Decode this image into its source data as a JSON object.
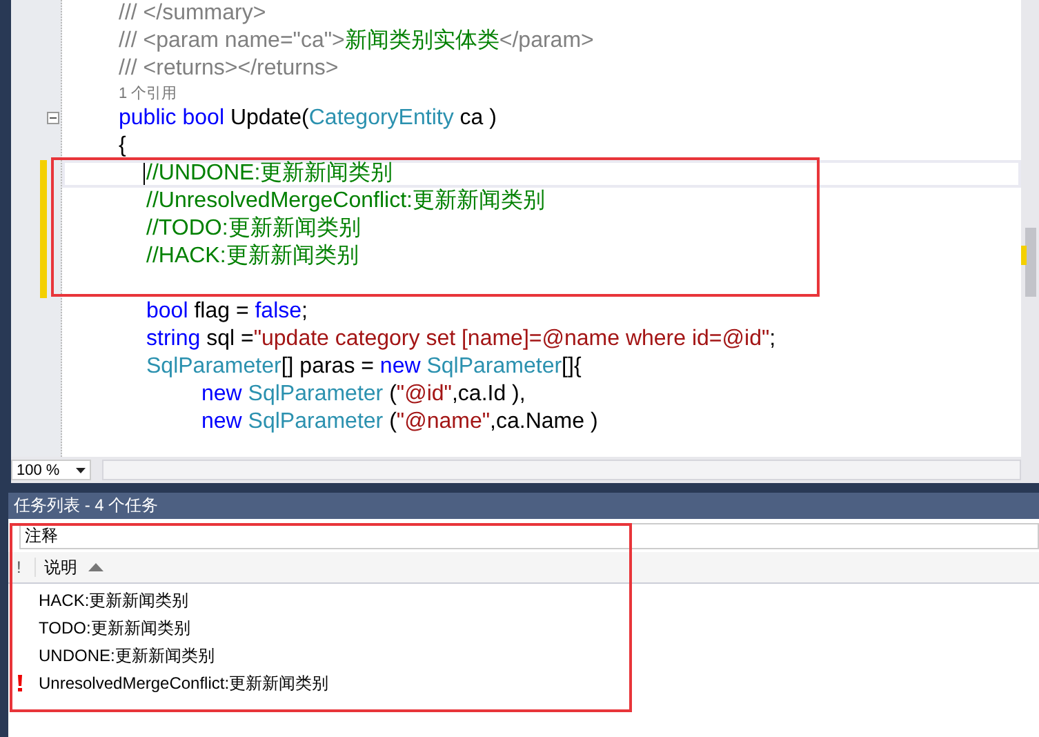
{
  "editor": {
    "lines": [
      {
        "kind": "member",
        "tokens": [
          {
            "kind": "doc",
            "text": "/// </summary>"
          }
        ]
      },
      {
        "kind": "member",
        "tokens": [
          {
            "kind": "doc",
            "text": "/// <param name=\"ca\">"
          },
          {
            "kind": "comment",
            "text": "新闻类别实体类"
          },
          {
            "kind": "doc",
            "text": "</param>"
          }
        ]
      },
      {
        "kind": "member",
        "tokens": [
          {
            "kind": "doc",
            "text": "/// <returns></returns>"
          }
        ]
      },
      {
        "kind": "lens",
        "tokens": [
          {
            "kind": "lens",
            "text": "1 个引用"
          }
        ]
      },
      {
        "kind": "member",
        "collapsible": true,
        "tokens": [
          {
            "kind": "keyword",
            "text": "public bool"
          },
          {
            "kind": "plain",
            "text": " Update("
          },
          {
            "kind": "type",
            "text": "CategoryEntity"
          },
          {
            "kind": "plain",
            "text": " ca )"
          }
        ]
      },
      {
        "kind": "member",
        "tokens": [
          {
            "kind": "plain",
            "text": "{"
          }
        ]
      },
      {
        "kind": "statement",
        "current": true,
        "changed": true,
        "tokens": [
          {
            "kind": "comment",
            "text": "//UNDONE:更新新闻类别"
          }
        ]
      },
      {
        "kind": "statement",
        "changed": true,
        "tokens": [
          {
            "kind": "comment",
            "text": "//UnresolvedMergeConflict:更新新闻类别"
          }
        ]
      },
      {
        "kind": "statement",
        "changed": true,
        "tokens": [
          {
            "kind": "comment",
            "text": "//TODO:更新新闻类别"
          }
        ]
      },
      {
        "kind": "statement",
        "changed": true,
        "tokens": [
          {
            "kind": "comment",
            "text": "//HACK:更新新闻类别"
          }
        ]
      },
      {
        "kind": "statement",
        "changed": true
      },
      {
        "kind": "statement",
        "tokens": [
          {
            "kind": "keyword",
            "text": "bool"
          },
          {
            "kind": "plain",
            "text": " flag = "
          },
          {
            "kind": "keyword",
            "text": "false"
          },
          {
            "kind": "plain",
            "text": ";"
          }
        ]
      },
      {
        "kind": "statement",
        "tokens": [
          {
            "kind": "keyword",
            "text": "string"
          },
          {
            "kind": "plain",
            "text": " sql ="
          },
          {
            "kind": "string",
            "text": "\"update category set [name]=@name where id=@id\""
          },
          {
            "kind": "plain",
            "text": ";"
          }
        ]
      },
      {
        "kind": "statement",
        "tokens": [
          {
            "kind": "type",
            "text": "SqlParameter"
          },
          {
            "kind": "plain",
            "text": "[] paras = "
          },
          {
            "kind": "keyword",
            "text": "new "
          },
          {
            "kind": "type",
            "text": "SqlParameter"
          },
          {
            "kind": "plain",
            "text": "[]{"
          }
        ]
      },
      {
        "kind": "argument",
        "tokens": [
          {
            "kind": "keyword",
            "text": "new "
          },
          {
            "kind": "type",
            "text": "SqlParameter"
          },
          {
            "kind": "plain",
            "text": " ("
          },
          {
            "kind": "string",
            "text": "\"@id\""
          },
          {
            "kind": "plain",
            "text": ",ca.Id ),"
          }
        ]
      },
      {
        "kind": "argument",
        "tokens": [
          {
            "kind": "keyword",
            "text": "new "
          },
          {
            "kind": "type",
            "text": "SqlParameter"
          },
          {
            "kind": "plain",
            "text": " ("
          },
          {
            "kind": "string",
            "text": "\"@name\""
          },
          {
            "kind": "plain",
            "text": ",ca.Name )"
          }
        ]
      }
    ],
    "zoom": "100 %"
  },
  "task_list": {
    "title": "任务列表 - 4 个任务",
    "filter": "注释",
    "columns": [
      "!",
      "说明"
    ],
    "rows": [
      {
        "high_priority": false,
        "text": "HACK:更新新闻类别"
      },
      {
        "high_priority": false,
        "text": "TODO:更新新闻类别"
      },
      {
        "high_priority": false,
        "text": "UNDONE:更新新闻类别"
      },
      {
        "high_priority": true,
        "text": "UnresolvedMergeConflict:更新新闻类别"
      }
    ]
  }
}
